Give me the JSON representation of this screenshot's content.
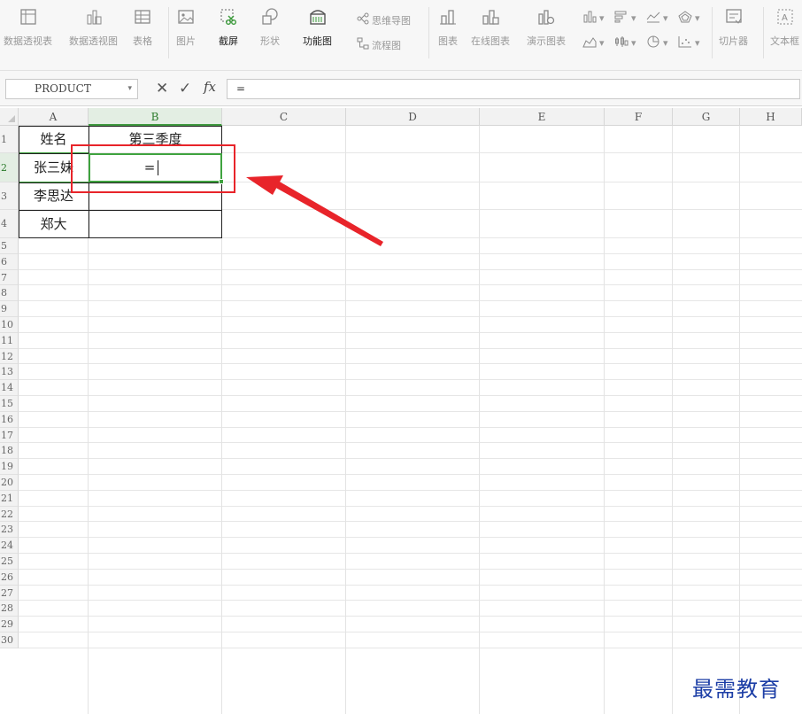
{
  "ribbon": {
    "pivot_table": "数据透视表",
    "pivot_chart": "数据透视图",
    "table": "表格",
    "picture": "图片",
    "screenshot": "截屏",
    "shapes": "形状",
    "function_chart": "功能图",
    "mindmap": "思维导图",
    "flowchart": "流程图",
    "chart": "图表",
    "online_chart": "在线图表",
    "demo_chart": "演示图表",
    "slicer": "切片器",
    "textbox": "文本框"
  },
  "formula_bar": {
    "name_box": "PRODUCT",
    "cancel": "✕",
    "confirm": "✓",
    "fx": "fx",
    "content": "="
  },
  "columns": [
    "A",
    "B",
    "C",
    "D",
    "E",
    "F",
    "G",
    "H"
  ],
  "rows": [
    "1",
    "2",
    "3",
    "4",
    "5",
    "6",
    "7",
    "8",
    "9",
    "10",
    "11",
    "12",
    "13",
    "14",
    "15",
    "16",
    "17",
    "18",
    "19",
    "20",
    "21",
    "22",
    "23",
    "24",
    "25",
    "26",
    "27",
    "28",
    "29",
    "30"
  ],
  "cells": {
    "A1": "姓名",
    "B1": "第三季度",
    "A2": "张三妹",
    "B2": "=",
    "A3": "李思达",
    "A4": "郑大"
  },
  "colors": {
    "highlight_red": "#e8242a",
    "active_green": "#3fa33f",
    "watermark_blue": "#1c3ea6"
  },
  "watermark": "最需教育"
}
